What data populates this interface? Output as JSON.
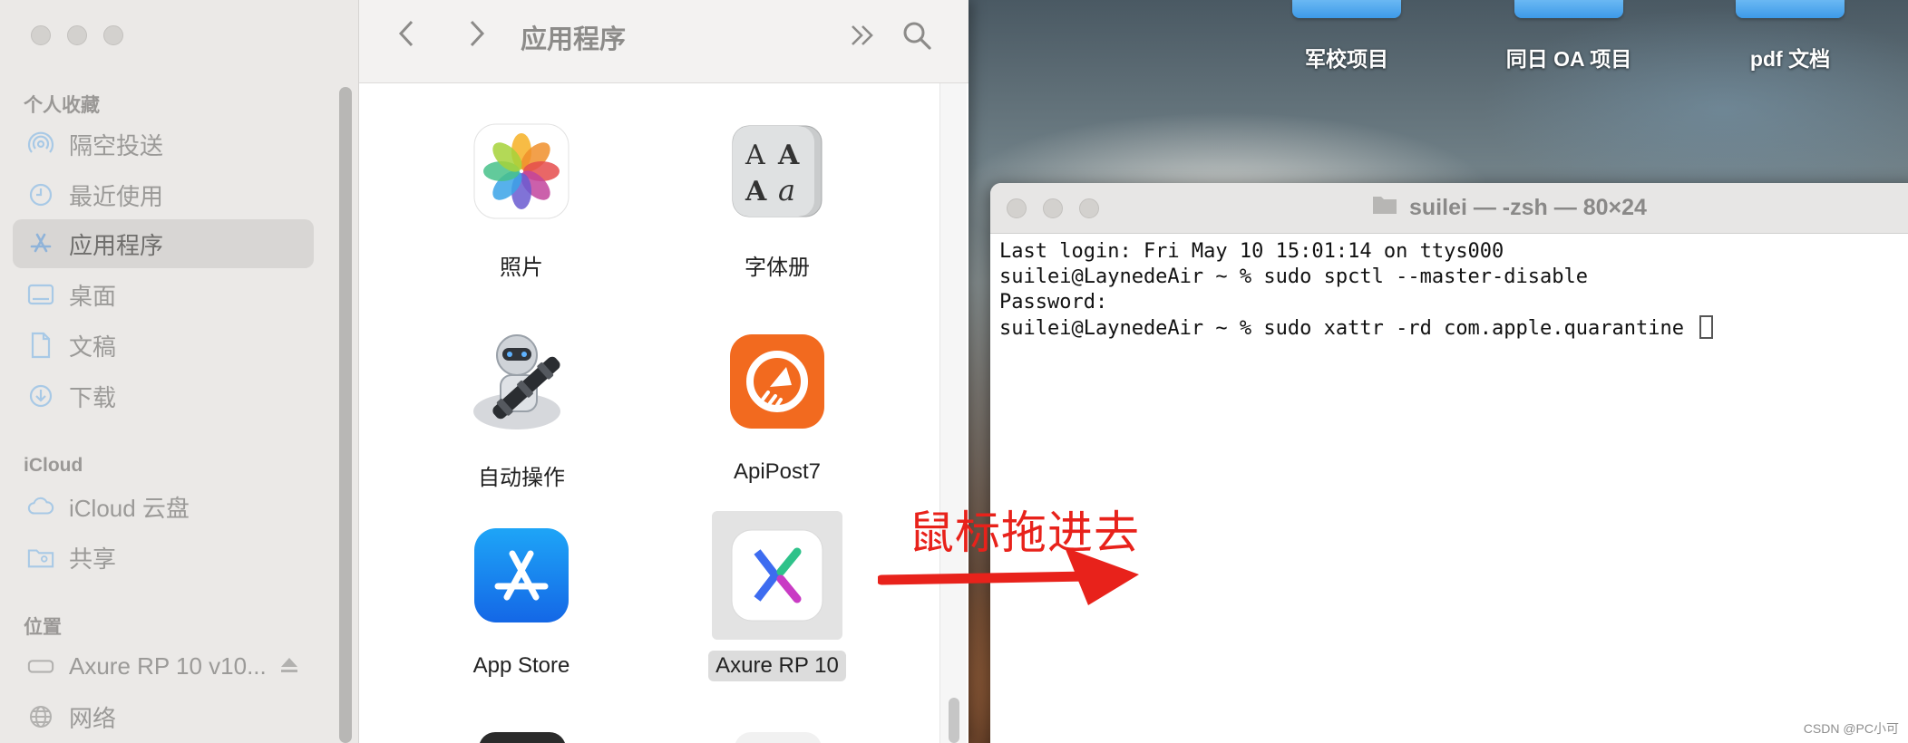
{
  "desktop": {
    "icons": [
      {
        "label": "军校项目"
      },
      {
        "label": "同日 OA 项目"
      },
      {
        "label": "pdf 文档"
      }
    ]
  },
  "finder": {
    "toolbar": {
      "back_icon": "chevron-left",
      "forward_icon": "chevron-right",
      "title": "应用程序",
      "more_icon": "double-chevron-right",
      "search_icon": "magnifier"
    },
    "sidebar": {
      "favorites_header": "个人收藏",
      "favorites": [
        {
          "label": "隔空投送",
          "icon": "airdrop-icon"
        },
        {
          "label": "最近使用",
          "icon": "clock-icon"
        },
        {
          "label": "应用程序",
          "icon": "applications-icon",
          "active": true
        },
        {
          "label": "桌面",
          "icon": "desktop-icon"
        },
        {
          "label": "文稿",
          "icon": "document-icon"
        },
        {
          "label": "下载",
          "icon": "download-icon"
        }
      ],
      "icloud_header": "iCloud",
      "icloud": [
        {
          "label": "iCloud 云盘",
          "icon": "cloud-icon"
        },
        {
          "label": "共享",
          "icon": "shared-folder-icon"
        }
      ],
      "locations_header": "位置",
      "locations": [
        {
          "label": "Axure RP 10 v10...",
          "icon": "disk-icon"
        },
        {
          "label": "网络",
          "icon": "globe-icon"
        }
      ]
    },
    "apps": [
      {
        "label": "照片",
        "icon": "photos-icon"
      },
      {
        "label": "字体册",
        "icon": "font-book-icon"
      },
      {
        "label": "自动操作",
        "icon": "automator-icon"
      },
      {
        "label": "ApiPost7",
        "icon": "apipost-icon"
      },
      {
        "label": "App Store",
        "icon": "app-store-icon"
      },
      {
        "label": "Axure RP 10",
        "icon": "axure-icon",
        "selected": true
      }
    ]
  },
  "terminal": {
    "title": "suilei — -zsh — 80×24",
    "lines": [
      "Last login: Fri May 10 15:01:14 on ttys000",
      "suilei@LaynedeAir ~ % sudo spctl --master-disable",
      "Password:",
      "suilei@LaynedeAir ~ % sudo xattr -rd com.apple.quarantine "
    ]
  },
  "annotation": {
    "text": "鼠标拖进去",
    "color": "#e8221b"
  },
  "watermark": "CSDN @PC小可"
}
